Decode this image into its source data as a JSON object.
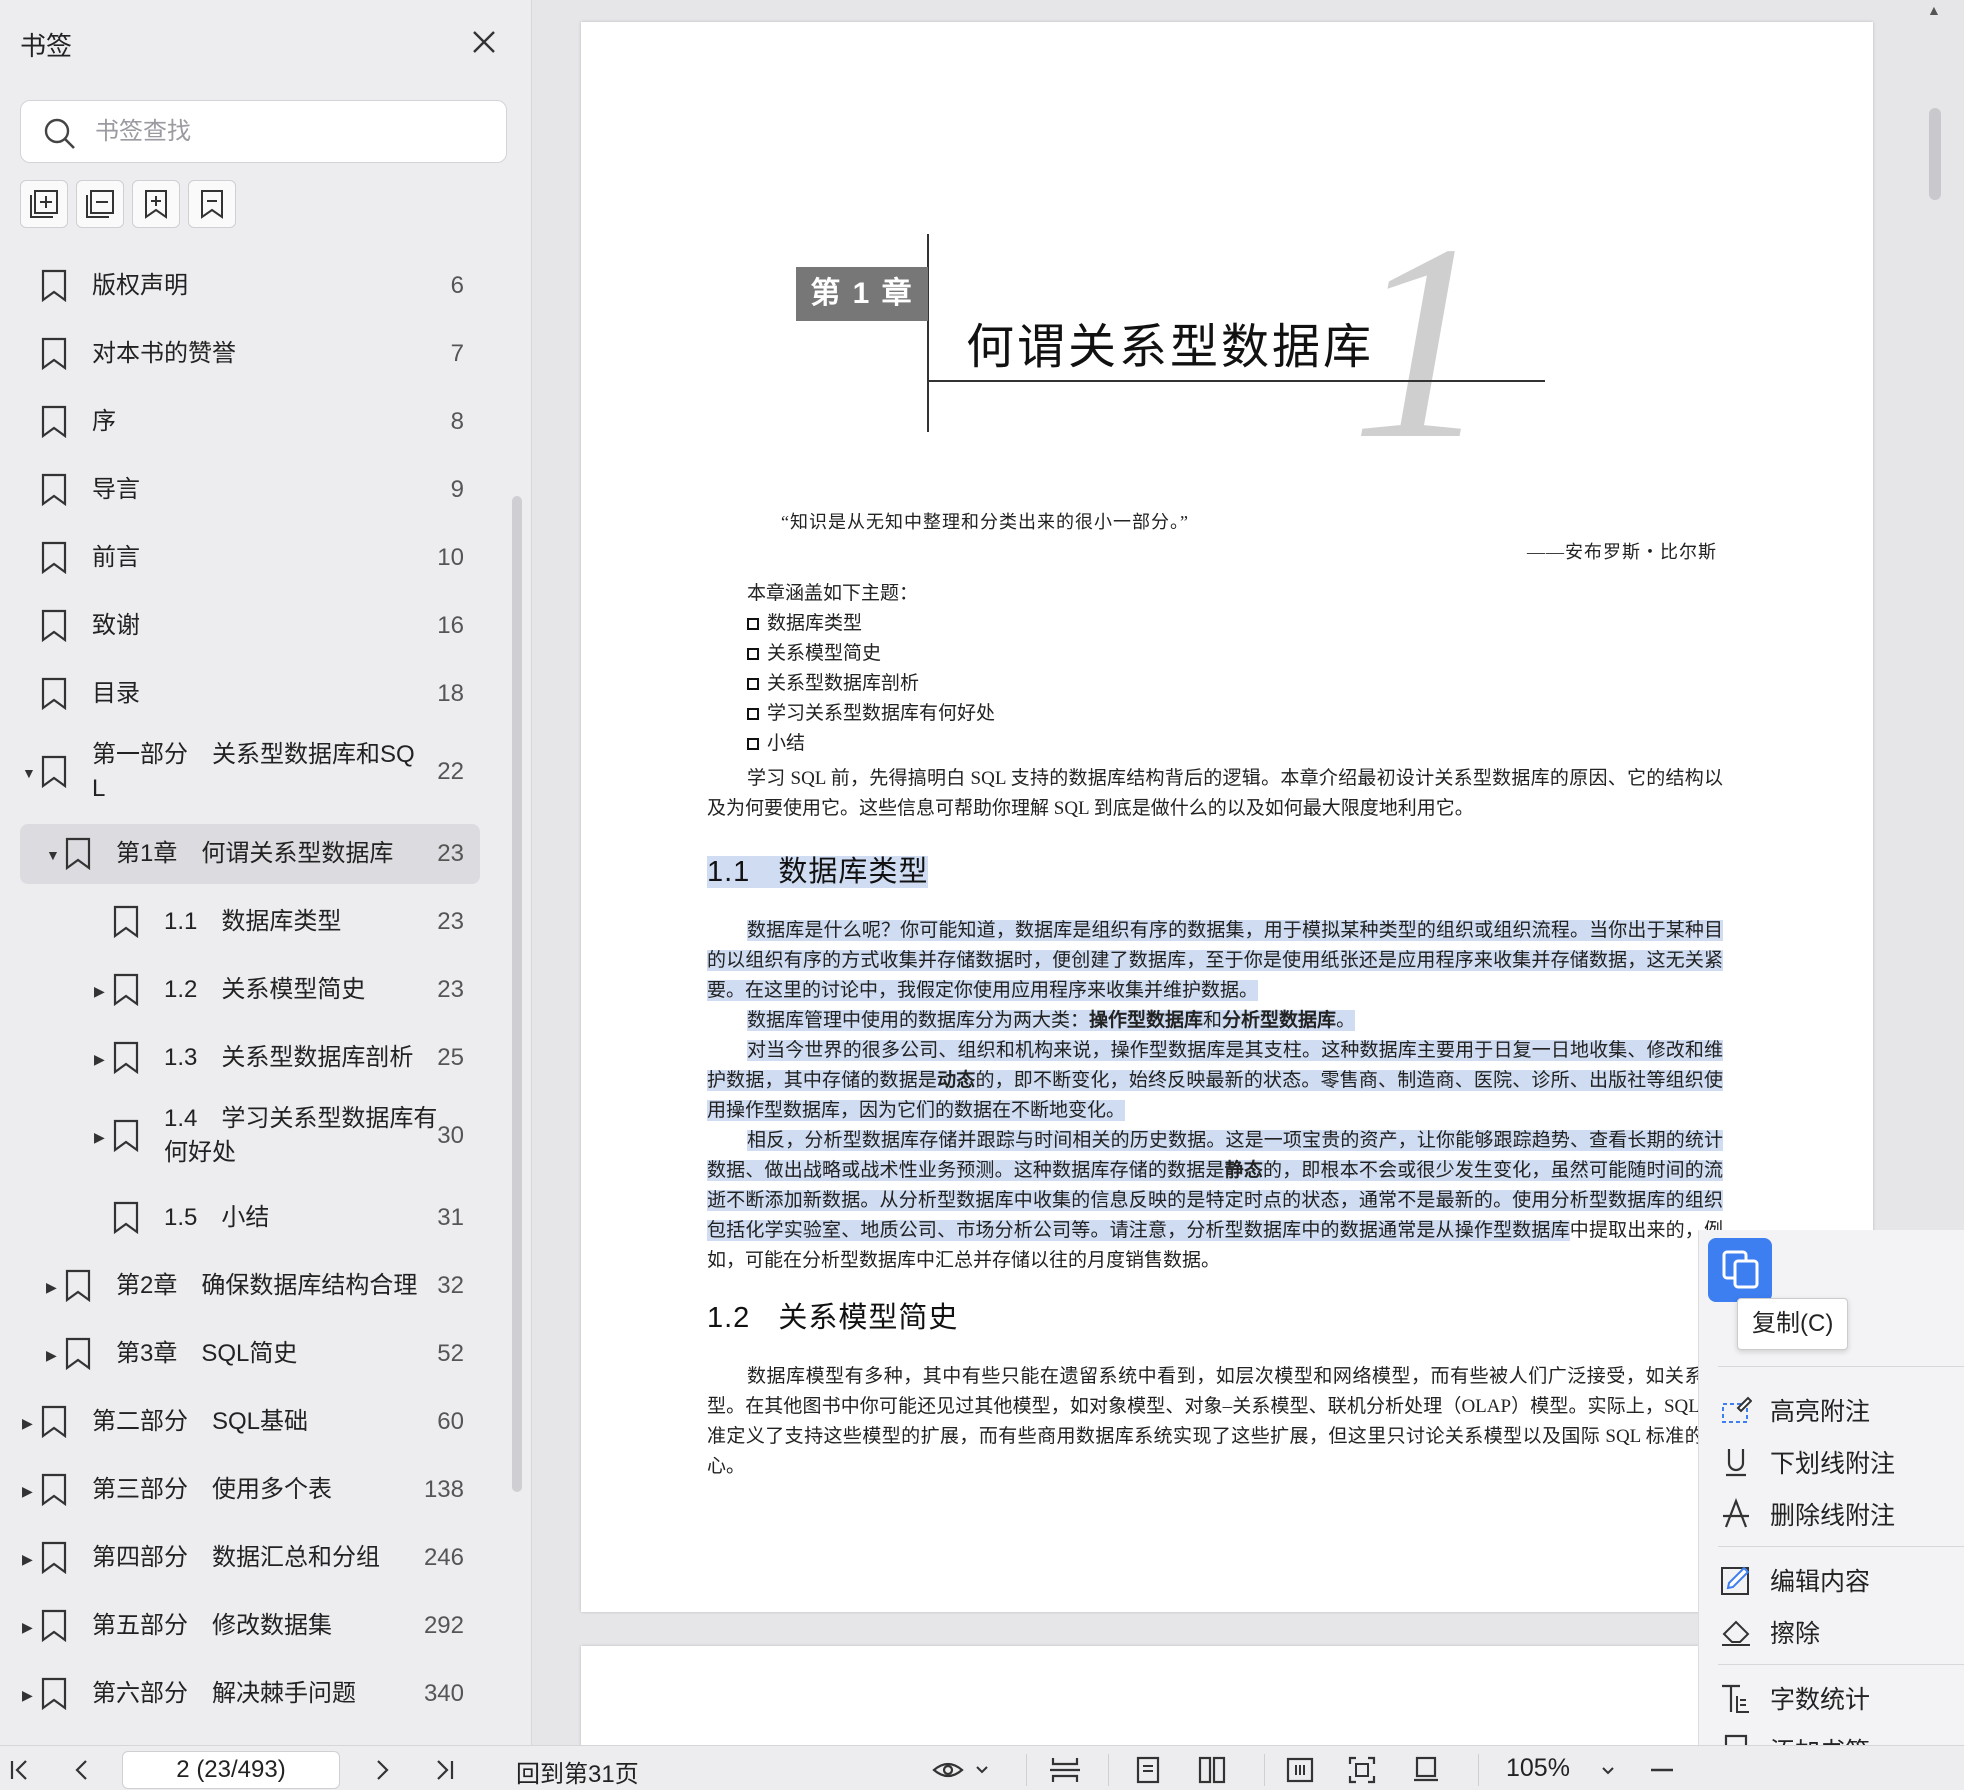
{
  "sidebar": {
    "title": "书签",
    "search_placeholder": "书签查找",
    "toc": [
      {
        "label": "版权声明",
        "page": "6"
      },
      {
        "label": "对本书的赞誉",
        "page": "7"
      },
      {
        "label": "序",
        "page": "8"
      },
      {
        "label": "导言",
        "page": "9"
      },
      {
        "label": "前言",
        "page": "10"
      },
      {
        "label": "致谢",
        "page": "16"
      },
      {
        "label": "目录",
        "page": "18"
      },
      {
        "label": "第一部分　关系型数据库和SQ\nL",
        "page": "22"
      },
      {
        "label": "第1章　何谓关系型数据库",
        "page": "23"
      },
      {
        "label": "1.1　数据库类型",
        "page": "23"
      },
      {
        "label": "1.2　关系模型简史",
        "page": "23"
      },
      {
        "label": "1.3　关系型数据库剖析",
        "page": "25"
      },
      {
        "label": "1.4　学习关系型数据库有\n何好处",
        "page": "30"
      },
      {
        "label": "1.5　小结",
        "page": "31"
      },
      {
        "label": "第2章　确保数据库结构合理",
        "page": "32"
      },
      {
        "label": "第3章　SQL简史",
        "page": "52"
      },
      {
        "label": "第二部分　SQL基础",
        "page": "60"
      },
      {
        "label": "第三部分　使用多个表",
        "page": "138"
      },
      {
        "label": "第四部分　数据汇总和分组",
        "page": "246"
      },
      {
        "label": "第五部分　修改数据集",
        "page": "292"
      },
      {
        "label": "第六部分　解决棘手问题",
        "page": "340"
      }
    ]
  },
  "document": {
    "chapter_badge": "第 1 章",
    "chapter_title": "何谓关系型数据库",
    "chapter_number": "1",
    "quote": "“知识是从无知中整理和分类出来的很小一部分。”",
    "quote_author": "——安布罗斯・比尔斯",
    "topics_intro": "本章涵盖如下主题：",
    "topics": [
      "数据库类型",
      "关系模型简史",
      "关系型数据库剖析",
      "学习关系型数据库有何好处",
      "小结"
    ],
    "intro_para": "学习 SQL 前，先得搞明白 SQL 支持的数据库结构背后的逻辑。本章介绍最初设计关系型数据库的原因、它的结构以及为何要使用它。这些信息可帮助你理解 SQL 到底是做什么的以及如何最大限度地利用它。",
    "section1": {
      "num": "1.1",
      "title": "数据库类型"
    },
    "s1_p1": "数据库是什么呢？你可能知道，数据库是组织有序的数据集，用于模拟某种类型的组织或组织流程。当你出于某种目的以组织有序的方式收集并存储数据时，便创建了数据库，至于你是使用纸张还是应用程序来收集并存储数据，这无关紧要。在这里的讨论中，我假定你使用应用程序来收集并维护数据。",
    "s1_p2_a": "数据库管理中使用的数据库分为两大类：",
    "s1_p2_b": "操作型数据库",
    "s1_p2_c": "和",
    "s1_p2_d": "分析型数据库",
    "s1_p2_e": "。",
    "s1_p3_a": "对当今世界的很多公司、组织和机构来说，操作型数据库是其支柱。这种数据库主要用于日复一日地收集、修改和维护数据，其中存储的数据是",
    "s1_p3_b": "动态",
    "s1_p3_c": "的，即不断变化，始终反映最新的状态。零售商、制造商、医院、诊所、出版社等组织使用操作型数据库，因为它们的数据在不断地变化。",
    "s1_p4_a": "相反，分析型数据库存储并跟踪与时间相关的历史数据。这是一项宝贵的资产，让你能够跟踪趋势、查看长期的统计数据、做出战略或战术性业务预测。这种数据库存储的数据是",
    "s1_p4_b": "静态",
    "s1_p4_c": "的，即根本不会或很少发生变化，虽然可能随时间的流逝不断添加新数据。从分析型数据库中收集的信息反映的是特定时点的状态，通常不是最新的。使用分析型数据库的组织包括化学实验室、地质公司、市场分析公司等。请注意，分析型数据库中的数据通常是从操作型数据库",
    "s1_p4_d": "中提取出来的，例如，可能在分析型数据库中汇总并存储以往的月度销售数据。",
    "section2": {
      "num": "1.2",
      "title": "关系模型简史"
    },
    "s2_p1": "数据库模型有多种，其中有些只能在遗留系统中看到，如层次模型和网络模型，而有些被人们广泛接受，如关系模型。在其他图书中你可能还见过其他模型，如对象模型、对象–关系模型、联机分析处理（OLAP）模型。实际上，SQL 标准定义了支持这些模型的扩展，而有些商用数据库系统实现了这些扩展，但这里只讨论关系模型以及国际 SQL 标准的核心。"
  },
  "context_menu": {
    "copy_tooltip": "复制(C)",
    "items": [
      "高亮附注",
      "下划线附注",
      "删除线附注",
      "编辑内容",
      "擦除",
      "字数统计",
      "添加书签"
    ]
  },
  "bottombar": {
    "page_value": "2 (23/493)",
    "goto_label": "回到第31页",
    "zoom": "105%"
  }
}
